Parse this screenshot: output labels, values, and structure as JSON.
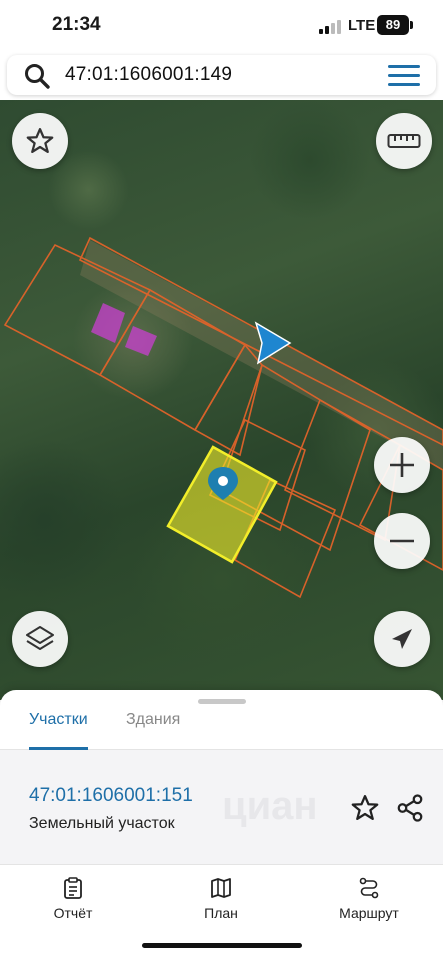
{
  "status": {
    "time": "21:34",
    "network": "LTE",
    "battery": "89"
  },
  "search": {
    "query": "47:01:1606001:149",
    "icon": "search-icon"
  },
  "map": {
    "buttons": {
      "favorite": "star-icon",
      "ruler": "ruler-icon",
      "zoom_in": "plus-icon",
      "zoom_out": "minus-icon",
      "layers": "layers-icon",
      "locate": "navigation-arrow-icon"
    },
    "colors": {
      "parcel_outline": "#e0632a",
      "selected_parcel": "#f2ee2a",
      "building": "#c93fd0",
      "marker": "#1e7fb0",
      "heading_arrow": "#1e86d0"
    }
  },
  "sheet": {
    "tabs": [
      {
        "label": "Участки",
        "active": true
      },
      {
        "label": "Здания",
        "active": false
      }
    ],
    "card": {
      "cadastral_id": "47:01:1606001:151",
      "type": "Земельный участок",
      "watermark": "циан"
    }
  },
  "nav": [
    {
      "label": "Отчёт",
      "icon": "report-icon"
    },
    {
      "label": "План",
      "icon": "map-icon"
    },
    {
      "label": "Маршрут",
      "icon": "route-icon"
    }
  ],
  "accent": "#1e6fa8"
}
